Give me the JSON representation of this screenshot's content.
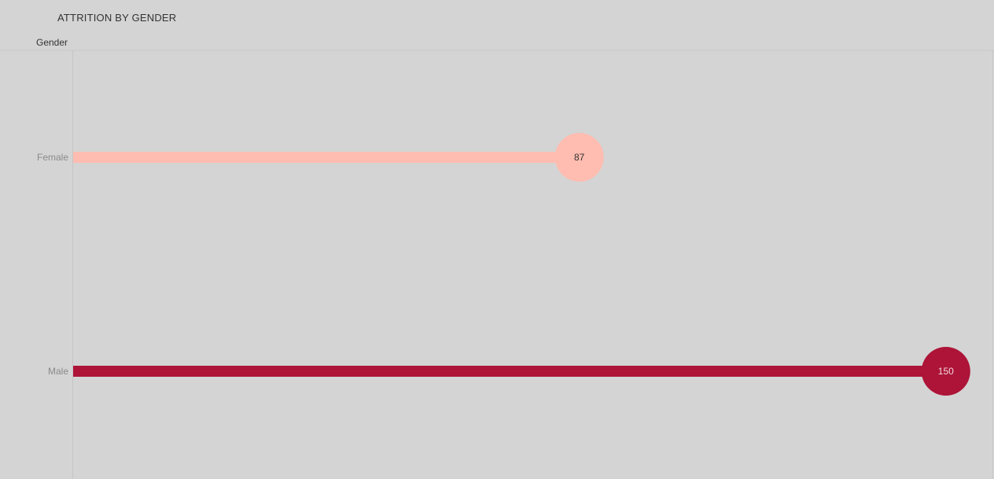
{
  "title": "ATTRITION BY GENDER",
  "row_header": "Gender",
  "chart_data": {
    "type": "bar",
    "style": "lollipop",
    "orientation": "horizontal",
    "title": "ATTRITION BY GENDER",
    "row_header": "Gender",
    "categories": [
      "Female",
      "Male"
    ],
    "values": [
      87,
      150
    ],
    "colors": [
      "#ffbcb0",
      "#ad1438"
    ],
    "label_colors": [
      "#333333",
      "#f3d6dc"
    ],
    "xlim": [
      0,
      158
    ],
    "grid": false,
    "legend": "none"
  }
}
